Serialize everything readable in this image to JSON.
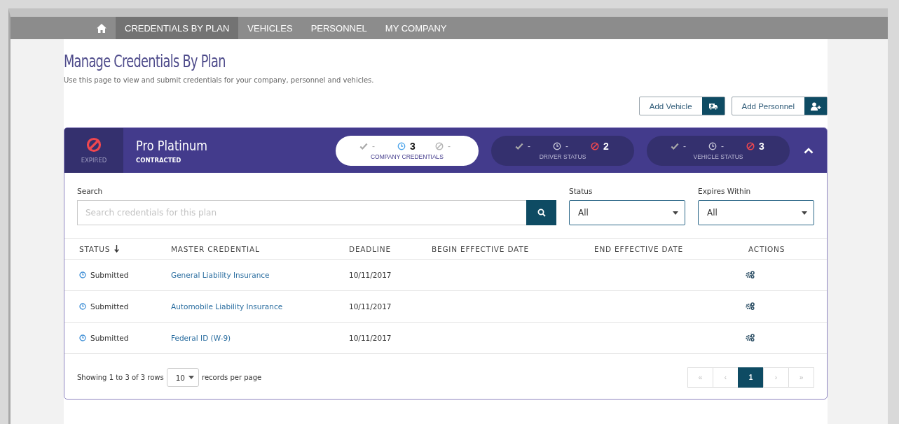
{
  "nav": {
    "items": [
      {
        "kind": "home",
        "selected": false
      },
      {
        "kind": "text",
        "label": "CREDENTIALS BY PLAN",
        "selected": true
      },
      {
        "kind": "text",
        "label": "VEHICLES",
        "selected": false
      },
      {
        "kind": "text",
        "label": "PERSONNEL",
        "selected": false
      },
      {
        "kind": "text",
        "label": "MY COMPANY",
        "selected": false
      }
    ]
  },
  "page": {
    "title": "Manage Credentials By Plan",
    "subtitle": "Use this page to view and submit credentials for your company, personnel and vehicles."
  },
  "actions": [
    {
      "label": "Add Vehicle",
      "kind": "vehicle"
    },
    {
      "label": "Add Personnel",
      "kind": "personnel"
    }
  ],
  "plan": {
    "status": "EXPIRED",
    "name": "Pro Platinum",
    "contract": "CONTRACTED",
    "expanded": true,
    "groups": [
      {
        "label": "COMPANY CREDENTIALS",
        "selected": true,
        "stats": [
          {
            "kind": "approved",
            "value": "-"
          },
          {
            "kind": "pending",
            "value": "3"
          },
          {
            "kind": "inactive",
            "value": "-"
          }
        ]
      },
      {
        "label": "DRIVER STATUS",
        "selected": false,
        "stats": [
          {
            "kind": "approved",
            "value": "-"
          },
          {
            "kind": "pending",
            "value": "-"
          },
          {
            "kind": "expired",
            "value": "2"
          }
        ]
      },
      {
        "label": "VEHICLE STATUS",
        "selected": false,
        "stats": [
          {
            "kind": "approved",
            "value": "-"
          },
          {
            "kind": "pending",
            "value": "-"
          },
          {
            "kind": "expired",
            "value": "3"
          }
        ]
      }
    ]
  },
  "filters": {
    "search": {
      "label": "Search",
      "placeholder": "Search credentials for this plan"
    },
    "status": {
      "label": "Status",
      "value": "All"
    },
    "expires": {
      "label": "Expires Within",
      "value": "All"
    }
  },
  "table": {
    "columns": [
      "STATUS",
      "MASTER CREDENTIAL",
      "DEADLINE",
      "BEGIN EFFECTIVE DATE",
      "END EFFECTIVE DATE",
      "ACTIONS"
    ],
    "rows": [
      {
        "status": "Submitted",
        "credential": "General Liability Insurance",
        "deadline": "10/11/2017"
      },
      {
        "status": "Submitted",
        "credential": "Automobile Liability Insurance",
        "deadline": "10/11/2017"
      },
      {
        "status": "Submitted",
        "credential": "Federal ID (W-9)",
        "deadline": "10/11/2017"
      }
    ]
  },
  "footer": {
    "showing": "Showing 1 to 3 of 3 rows",
    "page_size": "10",
    "suffix": "records per page",
    "pager": [
      {
        "label": "«",
        "selected": false
      },
      {
        "label": "‹",
        "selected": false
      },
      {
        "label": "1",
        "selected": true
      },
      {
        "label": "›",
        "selected": false
      },
      {
        "label": "»",
        "selected": false
      }
    ]
  }
}
